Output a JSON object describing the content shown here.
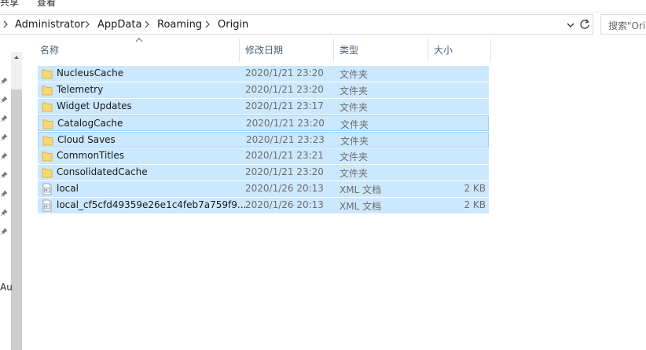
{
  "menu": {
    "share_label": "共享",
    "view_label": "查看"
  },
  "breadcrumb": [
    "Administrator",
    "AppData",
    "Roaming",
    "Origin"
  ],
  "search": {
    "placeholder": "搜索\"Origin\""
  },
  "nav": {
    "partial_label": "Au"
  },
  "columns": {
    "name": "名称",
    "date": "修改日期",
    "type": "类型",
    "size": "大小"
  },
  "files": [
    {
      "name": "NucleusCache",
      "date": "2020/1/21 23:20",
      "type": "文件夹",
      "size": "",
      "icon": "folder-icon"
    },
    {
      "name": "Telemetry",
      "date": "2020/1/21 23:20",
      "type": "文件夹",
      "size": "",
      "icon": "folder-icon"
    },
    {
      "name": "Widget Updates",
      "date": "2020/1/21 23:17",
      "type": "文件夹",
      "size": "",
      "icon": "folder-icon"
    },
    {
      "name": "CatalogCache",
      "date": "2020/1/21 23:20",
      "type": "文件夹",
      "size": "",
      "icon": "folder-icon"
    },
    {
      "name": "Cloud Saves",
      "date": "2020/1/21 23:23",
      "type": "文件夹",
      "size": "",
      "icon": "folder-icon"
    },
    {
      "name": "CommonTitles",
      "date": "2020/1/21 23:21",
      "type": "文件夹",
      "size": "",
      "icon": "folder-icon"
    },
    {
      "name": "ConsolidatedCache",
      "date": "2020/1/21 23:20",
      "type": "文件夹",
      "size": "",
      "icon": "folder-icon"
    },
    {
      "name": "local",
      "date": "2020/1/26 20:13",
      "type": "XML 文档",
      "size": "2 KB",
      "icon": "xml-file-icon"
    },
    {
      "name": "local_cf5cfd49359e26e1c4feb7a759f9...",
      "date": "2020/1/26 20:13",
      "type": "XML 文档",
      "size": "2 KB",
      "icon": "xml-file-icon"
    }
  ],
  "colors": {
    "selection": "#cce8ff",
    "selection_border": "#99d1ff",
    "folder": "#f8d775",
    "header_text": "#4c607a"
  }
}
